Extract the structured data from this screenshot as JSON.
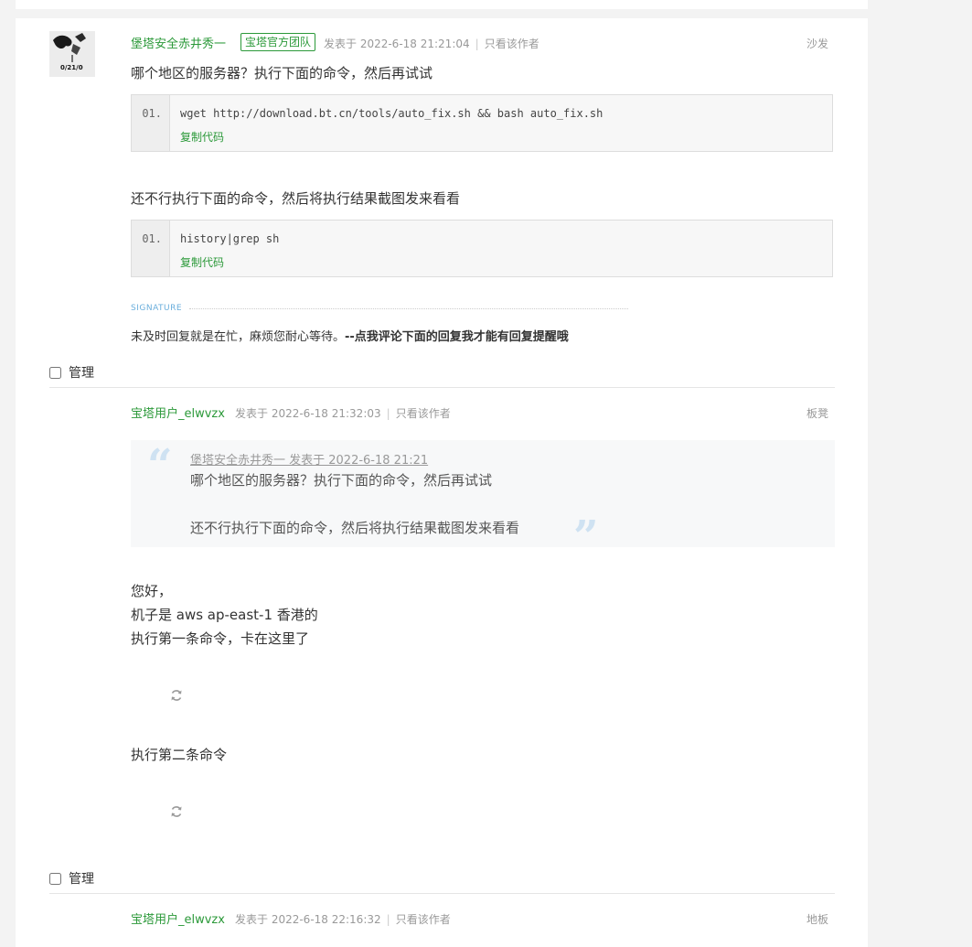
{
  "post1": {
    "author": "堡塔安全赤井秀一",
    "badge": "宝塔官方团队",
    "meta": "发表于 2022-6-18 21:21:04",
    "only_author": "只看该作者",
    "floor": "沙发",
    "avatar_text": "0/21/0",
    "intro": "哪个地区的服务器？执行下面的命令，然后再试试",
    "code1": {
      "line": "01.",
      "text": "wget http://download.bt.cn/tools/auto_fix.sh && bash auto_fix.sh",
      "copy": "复制代码"
    },
    "middle": "还不行执行下面的命令，然后将执行结果截图发来看看",
    "code2": {
      "line": "01.",
      "text": "history|grep sh",
      "copy": "复制代码"
    },
    "signature_label": "SIGNATURE",
    "signature_plain": "未及时回复就是在忙，麻烦您耐心等待。",
    "signature_bold": "--点我评论下面的回复我才能有回复提醒哦",
    "manage": "管理"
  },
  "post2": {
    "author": "宝塔用户_elwvzx",
    "meta": "发表于 2022-6-18 21:32:03",
    "only_author": "只看该作者",
    "floor": "板凳",
    "quote_source": "堡塔安全赤井秀一 发表于 2022-6-18 21:21",
    "quote_line1": "哪个地区的服务器？执行下面的命令，然后再试试",
    "quote_line2": "还不行执行下面的命令，然后将执行结果截图发来看看",
    "quote_open": "“",
    "quote_close": "”",
    "line1": "您好，",
    "line2": "机子是 aws ap-east-1 香港的",
    "line3": "执行第一条命令，卡在这里了",
    "line4": "执行第二条命令",
    "manage": "管理"
  },
  "post3": {
    "author": "宝塔用户_elwvzx",
    "meta": "发表于 2022-6-18 22:16:32",
    "only_author": "只看该作者",
    "floor": "地板"
  },
  "icons": {
    "reload": "reload-icon",
    "separator": "|"
  },
  "colors": {
    "accent": "#2b9939",
    "quote_mark": "#cfe2f2",
    "signature_label": "#6aaedc"
  }
}
